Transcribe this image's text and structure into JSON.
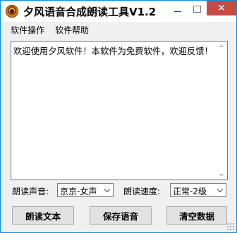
{
  "window": {
    "title": "夕风语音合成朗读工具V1.2",
    "accent": "#0a8fe0",
    "close_color": "#c74a42"
  },
  "icons": {
    "app": "speaker-app-icon",
    "minimize": "minimize-icon",
    "maximize": "maximize-icon",
    "close": "close-icon"
  },
  "menu": {
    "items": [
      "软件操作",
      "软件帮助"
    ]
  },
  "editor": {
    "text": "欢迎使用夕风软件！本软件为免费软件，欢迎反馈！"
  },
  "controls": {
    "voice_label": "朗读声音:",
    "voice_value": "京京-女声",
    "speed_label": "朗读速度:",
    "speed_value": "正常-2级"
  },
  "buttons": {
    "read": "朗读文本",
    "save": "保存语音",
    "clear": "清空数据"
  }
}
